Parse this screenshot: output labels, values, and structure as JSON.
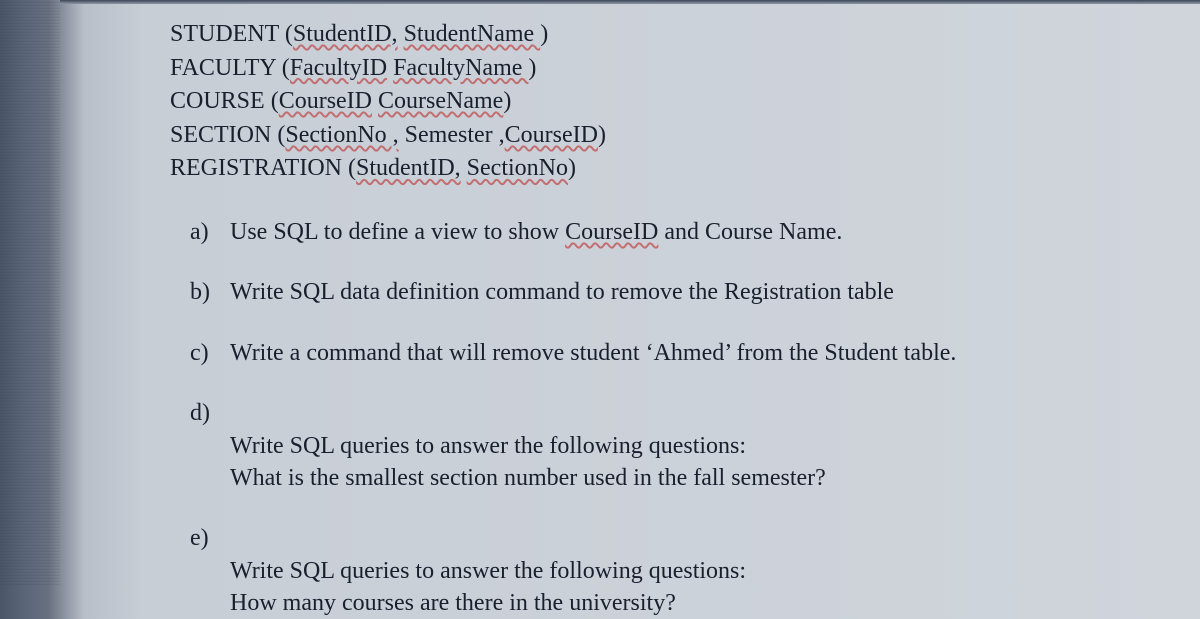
{
  "schema": {
    "lines": [
      {
        "relation": "STUDENT",
        "attrs_prefix": "(",
        "underlined1": "StudentID,",
        "plain1": " ",
        "underlined2": "StudentName ",
        "attrs_suffix": ")"
      },
      {
        "relation": "FACULTY",
        "attrs_prefix": "(",
        "underlined1": "FacultyID",
        "plain1": " ",
        "underlined2": "FacultyName ",
        "attrs_suffix": ")"
      },
      {
        "relation": "COURSE",
        "attrs_prefix": "(",
        "underlined1": "CourseID",
        "plain1": " ",
        "underlined2": "CourseName",
        "attrs_suffix": ")"
      },
      {
        "relation": "SECTION",
        "attrs_prefix": "(",
        "underlined1": "SectionNo ,",
        "plain1": " Semester ,",
        "underlined2": "CourseID",
        "attrs_suffix": ")"
      },
      {
        "relation": "REGISTRATION",
        "attrs_prefix": "(",
        "underlined1": "StudentID,",
        "plain1": " ",
        "underlined2": "SectionNo",
        "attrs_suffix": ")"
      }
    ]
  },
  "questions": [
    {
      "letter": "a)",
      "text_parts": [
        "Use SQL to define a view to show ",
        "CourseID",
        " and Course Name."
      ],
      "wavy_index": 1
    },
    {
      "letter": "b)",
      "text_parts": [
        "Write SQL data definition command to remove the Registration table"
      ],
      "wavy_index": -1
    },
    {
      "letter": "c)",
      "text_parts": [
        "Write a command that will remove student ‘Ahmed’ from the Student table."
      ],
      "wavy_index": -1
    },
    {
      "letter": "d)",
      "text_parts": [
        "Write SQL queries to answer the following questions:\nWhat is the smallest section number used in the fall semester?"
      ],
      "wavy_index": -1
    },
    {
      "letter": "e)",
      "text_parts": [
        "Write SQL queries to answer the following questions:\nHow many courses are there in the university?"
      ],
      "wavy_index": -1
    }
  ]
}
